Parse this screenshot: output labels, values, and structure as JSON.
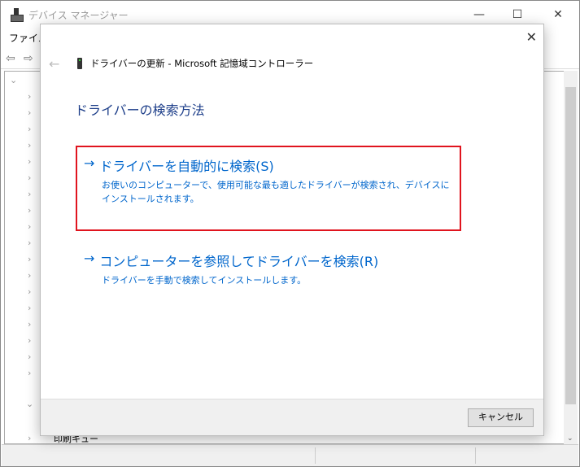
{
  "window": {
    "title": "デバイス マネージャー",
    "menu": [
      "ファイル"
    ],
    "minimize": "—",
    "maximize": "☐",
    "close": "✕",
    "status_item": "印刷キュー"
  },
  "dialog": {
    "close": "✕",
    "back": "←",
    "title": "ドライバーの更新 - Microsoft 記憶域コントローラー",
    "heading": "ドライバーの検索方法",
    "options": [
      {
        "arrow": "→",
        "title": "ドライバーを自動的に検索(S)",
        "desc": "お使いのコンピューターで、使用可能な最も適したドライバーが検索され、デバイスにインストールされます。"
      },
      {
        "arrow": "→",
        "title": "コンピューターを参照してドライバーを検索(R)",
        "desc": "ドライバーを手動で検索してインストールします。"
      }
    ],
    "cancel": "キャンセル"
  },
  "highlight_color": "#e0141e"
}
